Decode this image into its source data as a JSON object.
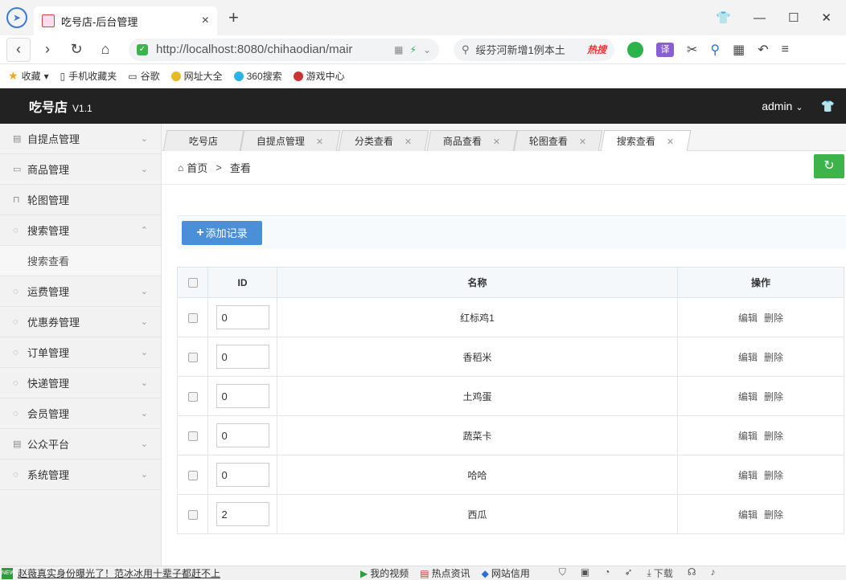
{
  "browser": {
    "tab_title": "吃号店-后台管理",
    "tab_close": "×",
    "new_tab": "+",
    "url": "http://localhost:8080/chihaodian/mair",
    "search_text": "绥芬河新增1例本土",
    "search_hot": "热搜"
  },
  "bookmarks": {
    "favorites": "收藏",
    "mobile": "手机收藏夹",
    "google": "谷歌",
    "nav": "网址大全",
    "s360": "360搜索",
    "games": "游戏中心"
  },
  "header": {
    "app_title": "吃号店",
    "version": "V1.1",
    "user": "admin"
  },
  "sidebar": {
    "items": [
      {
        "label": "自提点管理"
      },
      {
        "label": "商品管理"
      },
      {
        "label": "轮图管理"
      },
      {
        "label": "搜索管理"
      },
      {
        "label": "搜索查看"
      },
      {
        "label": "运费管理"
      },
      {
        "label": "优惠券管理"
      },
      {
        "label": "订单管理"
      },
      {
        "label": "快递管理"
      },
      {
        "label": "会员管理"
      },
      {
        "label": "公众平台"
      },
      {
        "label": "系统管理"
      }
    ]
  },
  "page_tabs": [
    "吃号店",
    "自提点管理",
    "分类查看",
    "商品查看",
    "轮图查看",
    "搜索查看"
  ],
  "breadcrumb": {
    "home": "首页",
    "sep": ">",
    "current": "查看"
  },
  "toolbar": {
    "add_label": "添加记录"
  },
  "table": {
    "headers": {
      "id": "ID",
      "name": "名称",
      "action": "操作"
    },
    "edit": "编辑",
    "delete": "删除",
    "rows": [
      {
        "id": "0",
        "name": "红标鸡1"
      },
      {
        "id": "0",
        "name": "香稻米"
      },
      {
        "id": "0",
        "name": "土鸡蛋"
      },
      {
        "id": "0",
        "name": "蔬菜卡"
      },
      {
        "id": "0",
        "name": "哈哈"
      },
      {
        "id": "2",
        "name": "西瓜"
      }
    ]
  },
  "statusbar": {
    "news": "赵薇真实身份曝光了！范冰冰用十辈子都赶不上",
    "video": "我的视频",
    "hot": "热点资讯",
    "credit": "网站信用",
    "download": "下载"
  }
}
